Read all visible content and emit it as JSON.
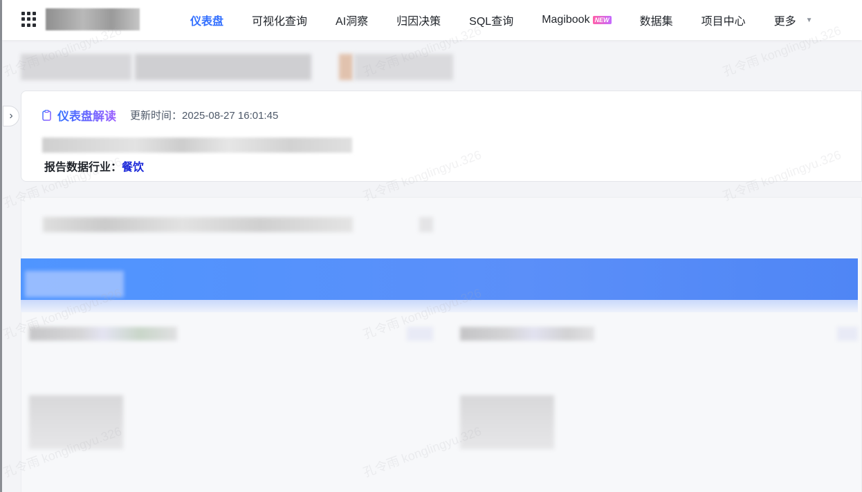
{
  "nav": {
    "items": [
      {
        "label": "仪表盘",
        "active": true
      },
      {
        "label": "可视化查询",
        "active": false
      },
      {
        "label": "AI洞察",
        "active": false
      },
      {
        "label": "归因决策",
        "active": false
      },
      {
        "label": "SQL查询",
        "active": false
      },
      {
        "label": "Magibook",
        "active": false,
        "badge": "NEW"
      },
      {
        "label": "数据集",
        "active": false
      },
      {
        "label": "项目中心",
        "active": false
      },
      {
        "label": "更多",
        "active": false
      }
    ]
  },
  "summary": {
    "title": "仪表盘解读",
    "update_time": "更新时间：2025-08-27 16:01:45",
    "industry_label": "报告数据行业：",
    "industry_value": "餐饮"
  },
  "watermark": "孔令雨 konglingyu.326",
  "colors": {
    "accent": "#3370ff",
    "band": "#5b8ff9",
    "industry_value": "#1a27d8"
  }
}
